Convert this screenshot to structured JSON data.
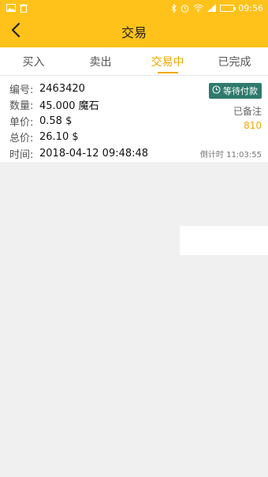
{
  "status_bar": {
    "time": "09:56",
    "left_icons": [
      "image-icon",
      "trash-icon"
    ],
    "right_icons": [
      "bluetooth-icon",
      "alarm-icon",
      "wifi-icon",
      "signal-icon",
      "battery-icon"
    ]
  },
  "header": {
    "title": "交易",
    "back_icon": "chevron-left-icon"
  },
  "tabs": [
    {
      "label": "买入",
      "active": false
    },
    {
      "label": "卖出",
      "active": false
    },
    {
      "label": "交易中",
      "active": true
    },
    {
      "label": "已完成",
      "active": false
    }
  ],
  "order": {
    "id_label": "编号:",
    "id_value": "2463420",
    "qty_label": "数量:",
    "qty_value": "45.000 魔石",
    "price_label": "单价:",
    "price_value": "0.58 $",
    "total_label": "总价:",
    "total_value": "26.10 $",
    "time_label": "时间:",
    "time_value": "2018-04-12 09:48:48",
    "status": "等待付款",
    "remark_label": "已备注",
    "remark_value": "810",
    "countdown": "倒计时 11:03:55"
  },
  "colors": {
    "brand": "#ffc21a",
    "accent": "#f0a800",
    "badge": "#2f7a6d"
  }
}
